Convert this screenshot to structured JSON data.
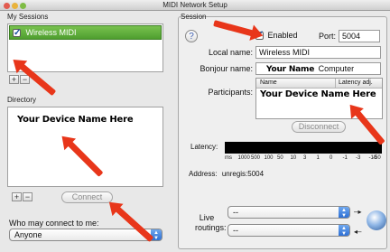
{
  "window": {
    "title": "MIDI Network Setup"
  },
  "my_sessions": {
    "label": "My Sessions",
    "items": [
      {
        "name": "Wireless MIDI",
        "checked": true
      }
    ]
  },
  "directory": {
    "label": "Directory",
    "placeholder_note": "Your Device Name Here",
    "connect_label": "Connect"
  },
  "who_may_connect": {
    "label": "Who may connect to me:",
    "value": "Anyone"
  },
  "session": {
    "label": "Session",
    "enabled_label": "Enabled",
    "enabled": true,
    "port_label": "Port:",
    "port_value": "5004",
    "local_name_label": "Local name:",
    "local_name_value": "Wireless MIDI",
    "bonjour_label": "Bonjour name:",
    "bonjour_value_bold": "Your Name",
    "bonjour_value_suffix": "Computer",
    "participants_label": "Participants:",
    "participants_columns": [
      "Name",
      "Latency adj."
    ],
    "participants_note": "Your Device Name Here",
    "disconnect_label": "Disconnect",
    "latency_label": "Latency:",
    "latency_ticks": [
      "ms",
      "1000",
      "500",
      "100",
      "50",
      "10",
      "3",
      "1",
      "0",
      "-1",
      "-3",
      "-10",
      "-50"
    ],
    "address_label": "Address:",
    "address_value": "unregis:5004",
    "live_routings_label": "Live routings:",
    "routing_values": [
      "--",
      "--"
    ]
  },
  "help": {
    "glyph": "?"
  },
  "colors": {
    "arrow": "#e8361a",
    "selection": "#5aa93a",
    "accent": "#2d6fd4"
  }
}
